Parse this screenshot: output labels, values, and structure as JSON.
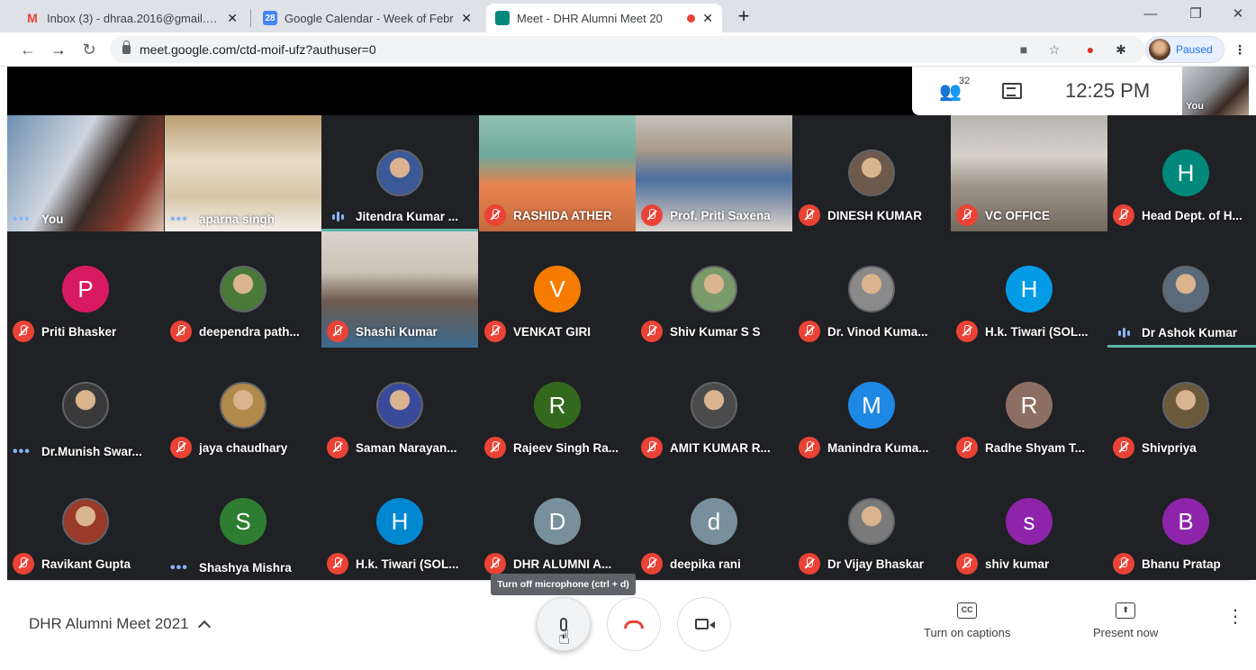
{
  "browser": {
    "tabs": [
      {
        "label": "Inbox (3) - dhraa.2016@gmail.com",
        "favicon": "M",
        "color": "#ea4335",
        "close": "✕"
      },
      {
        "label": "Google Calendar - Week of Febr",
        "favicon": "28",
        "color": "#4285f4",
        "close": "✕"
      },
      {
        "label": "Meet - DHR Alumni Meet 20",
        "favicon": "",
        "color": "#00897b",
        "close": "✕"
      }
    ],
    "new_tab": "+",
    "url": "meet.google.com/ctd-moif-ufz?authuser=0",
    "profile_label": "Paused"
  },
  "meet": {
    "participants_count": "32",
    "clock": "12:25 PM",
    "self_label": "You",
    "tooltip": "Turn off microphone (ctrl + d)",
    "meeting_title": "DHR Alumni Meet 2021",
    "captions_icon": "CC",
    "captions_label": "Turn on captions",
    "present_icon": "⬆",
    "present_label": "Present now",
    "more_label": "⋮",
    "tiles": [
      {
        "name": "You",
        "status": "dots"
      },
      {
        "name": "aparna singh",
        "status": "dots"
      },
      {
        "name": "Jitendra Kumar ...",
        "status": "speaking"
      },
      {
        "name": "RASHIDA ATHER",
        "status": "muted"
      },
      {
        "name": "Prof. Priti Saxena",
        "status": "muted"
      },
      {
        "name": "DINESH KUMAR",
        "status": "muted"
      },
      {
        "name": "VC OFFICE",
        "status": "muted"
      },
      {
        "name": "Head Dept. of H...",
        "status": "muted",
        "initial": "H",
        "color": "#00897b"
      },
      {
        "name": "Priti Bhasker",
        "status": "muted",
        "initial": "P",
        "color": "#d81b60"
      },
      {
        "name": "deependra path...",
        "status": "muted"
      },
      {
        "name": "Shashi Kumar",
        "status": "muted"
      },
      {
        "name": "VENKAT GIRI",
        "status": "muted",
        "initial": "V",
        "color": "#f57c00"
      },
      {
        "name": "Shiv Kumar S S",
        "status": "muted"
      },
      {
        "name": "Dr. Vinod Kuma...",
        "status": "muted"
      },
      {
        "name": "H.k. Tiwari (SOL...",
        "status": "muted",
        "initial": "H",
        "color": "#039be5"
      },
      {
        "name": "Dr Ashok Kumar",
        "status": "speaking"
      },
      {
        "name": "Dr.Munish Swar...",
        "status": "dots"
      },
      {
        "name": "jaya chaudhary",
        "status": "muted"
      },
      {
        "name": "Saman Narayan...",
        "status": "muted"
      },
      {
        "name": "Rajeev Singh Ra...",
        "status": "muted",
        "initial": "R",
        "color": "#33691e"
      },
      {
        "name": "AMIT KUMAR R...",
        "status": "muted"
      },
      {
        "name": "Manindra Kuma...",
        "status": "muted",
        "initial": "M",
        "color": "#1e88e5"
      },
      {
        "name": "Radhe Shyam T...",
        "status": "muted",
        "initial": "R",
        "color": "#8d6e63"
      },
      {
        "name": "Shivpriya",
        "status": "muted"
      },
      {
        "name": "Ravikant Gupta",
        "status": "muted"
      },
      {
        "name": "Shashya Mishra",
        "status": "dots",
        "initial": "S",
        "color": "#2e7d32"
      },
      {
        "name": "H.k. Tiwari (SOL...",
        "status": "muted",
        "initial": "H",
        "color": "#0288d1"
      },
      {
        "name": "DHR ALUMNI A...",
        "status": "muted",
        "initial": "D",
        "color": "#78909c"
      },
      {
        "name": "deepika rani",
        "status": "muted",
        "initial": "d",
        "color": "#78909c"
      },
      {
        "name": "Dr Vijay Bhaskar",
        "status": "muted"
      },
      {
        "name": "shiv kumar",
        "status": "muted",
        "initial": "s",
        "color": "#8e24aa"
      },
      {
        "name": "Bhanu Pratap",
        "status": "muted",
        "initial": "B",
        "color": "#8e24aa"
      }
    ]
  }
}
